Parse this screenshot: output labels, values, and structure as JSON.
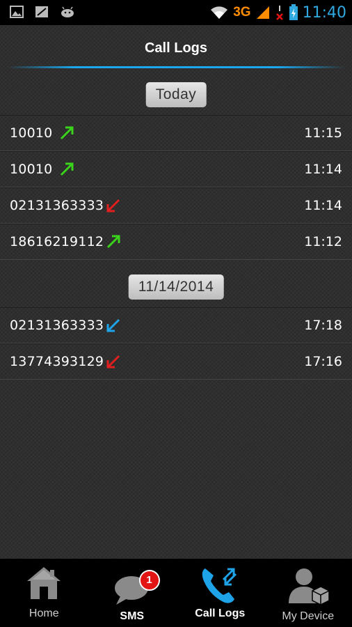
{
  "status_bar": {
    "network": "3G",
    "time": "11:40",
    "icons": [
      "image-icon",
      "no-signal-icon",
      "android-icon",
      "wifi-icon",
      "signal-icon",
      "no-sim-icon",
      "battery-icon"
    ]
  },
  "header": {
    "title": "Call Logs"
  },
  "groups": [
    {
      "date_label": "Today",
      "calls": [
        {
          "number": "10010",
          "time": "11:15",
          "type": "outgoing",
          "color": "#3bd21c"
        },
        {
          "number": "10010",
          "time": "11:14",
          "type": "outgoing",
          "color": "#3bd21c"
        },
        {
          "number": "02131363333",
          "time": "11:14",
          "type": "missed",
          "color": "#e01f1f"
        },
        {
          "number": "18616219112",
          "time": "11:12",
          "type": "outgoing",
          "color": "#3bd21c"
        }
      ]
    },
    {
      "date_label": "11/14/2014",
      "calls": [
        {
          "number": "02131363333",
          "time": "17:18",
          "type": "incoming",
          "color": "#1ea3e8"
        },
        {
          "number": "13774393129",
          "time": "17:16",
          "type": "missed",
          "color": "#e01f1f"
        }
      ]
    }
  ],
  "bottom_nav": {
    "tabs": [
      {
        "label": "Home",
        "icon": "home-icon"
      },
      {
        "label": "SMS",
        "icon": "chat-bubble-icon",
        "badge": "1"
      },
      {
        "label": "Call Logs",
        "icon": "phone-calls-icon",
        "active": true
      },
      {
        "label": "My Device",
        "icon": "user-device-icon"
      }
    ]
  }
}
